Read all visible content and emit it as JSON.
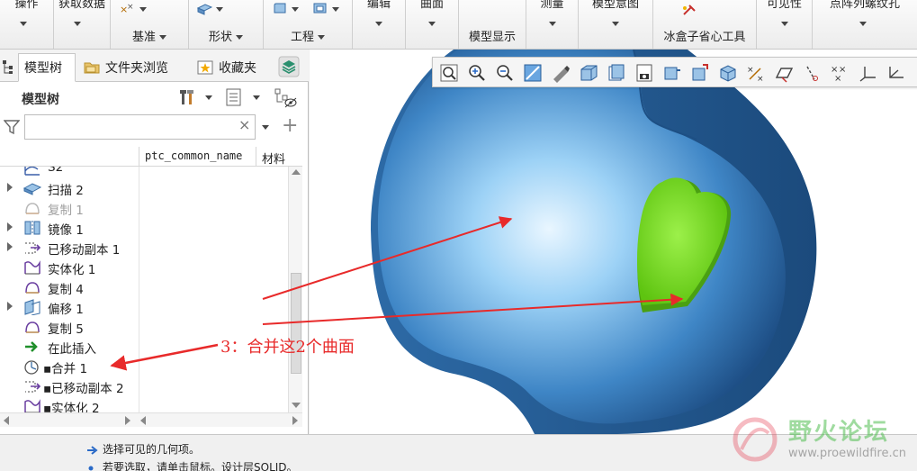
{
  "ribbon": {
    "groups": [
      {
        "label": "",
        "cut_label": "操作"
      },
      {
        "label": "",
        "cut_label": "获取数据"
      },
      {
        "label": "基准"
      },
      {
        "label": "形状"
      },
      {
        "label": "工程"
      },
      {
        "label": "",
        "cut_label": "编辑"
      },
      {
        "label": "",
        "cut_label": "曲面"
      },
      {
        "label": "模型显示"
      },
      {
        "label": "",
        "cut_label": "测量"
      },
      {
        "label": "",
        "cut_label": "模型意图"
      },
      {
        "label": "冰盒子省心工具"
      },
      {
        "label": "",
        "cut_label": "可见性"
      },
      {
        "label": "",
        "cut_label": "点阵列螺纹孔"
      }
    ]
  },
  "panel": {
    "tabs": [
      {
        "label": "模型树",
        "icon": "model-tree-icon"
      },
      {
        "label": "文件夹浏览",
        "icon": "folder-icon"
      },
      {
        "label": "收藏夹",
        "icon": "favorites-icon"
      }
    ],
    "tree_title": "模型树",
    "filter_value": "",
    "columns": [
      "ptc_common_name",
      "材料"
    ],
    "items": [
      {
        "label": "S2",
        "icon": "sketch-icon",
        "expandable": false,
        "dim": false
      },
      {
        "label": "扫描 2",
        "icon": "sweep-icon",
        "expandable": true,
        "dim": false
      },
      {
        "label": "复制 1",
        "icon": "copy-icon",
        "expandable": false,
        "dim": true
      },
      {
        "label": "镜像 1",
        "icon": "mirror-icon",
        "expandable": true,
        "dim": false
      },
      {
        "label": "已移动副本 1",
        "icon": "moved-copy-icon",
        "expandable": true,
        "dim": false
      },
      {
        "label": "实体化 1",
        "icon": "solidify-icon",
        "expandable": false,
        "dim": false
      },
      {
        "label": "复制 4",
        "icon": "copy-icon",
        "expandable": false,
        "dim": false
      },
      {
        "label": "偏移 1",
        "icon": "offset-icon",
        "expandable": true,
        "dim": false
      },
      {
        "label": "复制 5",
        "icon": "copy-icon",
        "expandable": false,
        "dim": false
      },
      {
        "label": "在此插入",
        "icon": "insert-here-icon",
        "expandable": false,
        "dim": false
      },
      {
        "label": "▪合并 1",
        "icon": "merge-icon",
        "expandable": false,
        "dim": false
      },
      {
        "label": "▪已移动副本 2",
        "icon": "moved-copy-icon",
        "expandable": false,
        "dim": false
      },
      {
        "label": "▪实体化 2",
        "icon": "solidify-icon",
        "expandable": false,
        "dim": false
      }
    ]
  },
  "annotation": {
    "text": "3：合并这2个曲面",
    "color": "#e82a2a"
  },
  "status": {
    "messages": [
      "选择可见的几何项。",
      "若要选取，请单击鼠标。设计层SOLID。"
    ]
  },
  "watermark": {
    "name": "野火论坛",
    "url": "www.proewildfire.cn"
  },
  "colors": {
    "body_blue": "#3f86c6",
    "heart_green": "#6fd21a",
    "arrow_red": "#e82a2a"
  }
}
